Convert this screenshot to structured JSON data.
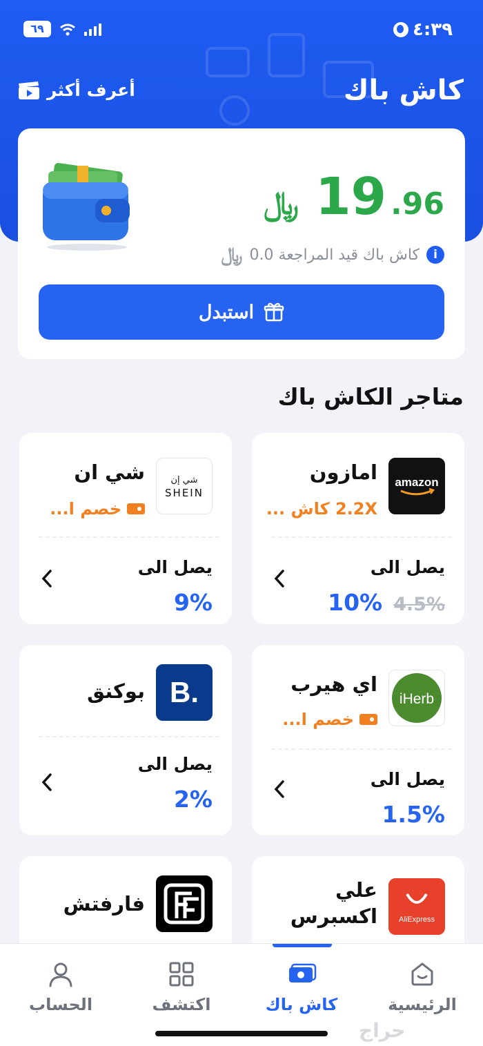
{
  "status_bar": {
    "time": "٤:٣٩",
    "battery": "٦٩"
  },
  "header": {
    "title": "كاش باك",
    "learn_more": "أعرف أكثر"
  },
  "balance": {
    "currency_symbol": "﷼",
    "amount_whole": "19",
    "amount_decimal": ".96",
    "pending_text": "كاش باك قيد المراجعة 0.0",
    "info_icon": "i",
    "redeem_label": "استبدل"
  },
  "section": {
    "title": "متاجر الكاش باك"
  },
  "stores": [
    {
      "name": "امازون",
      "logo_text": "amazon",
      "offer": "2.2X كاش ...",
      "upto_label": "يصل الى",
      "rate": "10%",
      "old_rate": "4.5%"
    },
    {
      "name": "شي ان",
      "logo_text": "SHEIN",
      "logo_text_ar": "شي إن",
      "offer": "خصم ا...",
      "upto_label": "يصل الى",
      "rate": "9%"
    },
    {
      "name": "اي هيرب",
      "logo_text": "iHerb",
      "offer": "خصم ا...",
      "upto_label": "يصل الى",
      "rate": "1.5%"
    },
    {
      "name": "بوكنق",
      "logo_text": "B.",
      "upto_label": "يصل الى",
      "rate": "2%"
    },
    {
      "name": "علي اكسبرس",
      "logo_text": "AliExpress"
    },
    {
      "name": "فارفتش",
      "logo_text": "FF"
    }
  ],
  "tabs": [
    {
      "label": "الرئيسية",
      "icon": "home-icon"
    },
    {
      "label": "كاش باك",
      "icon": "cashback-icon",
      "active": true
    },
    {
      "label": "اكتشف",
      "icon": "grid-icon"
    },
    {
      "label": "الحساب",
      "icon": "user-icon"
    }
  ],
  "watermark": "حراج",
  "colors": {
    "primary": "#2563f0",
    "header": "#1f5cf2",
    "amount": "#2ca84a",
    "offer": "#f08020"
  }
}
